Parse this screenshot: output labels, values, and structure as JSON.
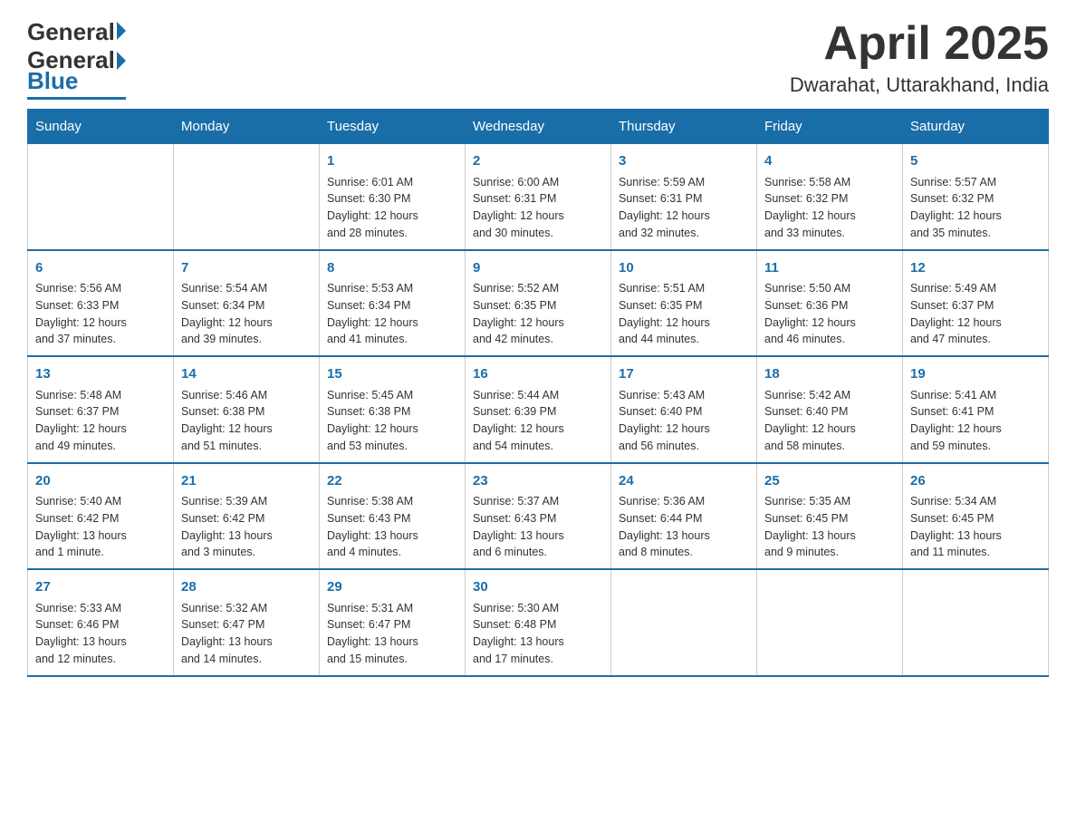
{
  "header": {
    "logo_general": "General",
    "logo_blue": "Blue",
    "month": "April 2025",
    "location": "Dwarahat, Uttarakhand, India"
  },
  "days_of_week": [
    "Sunday",
    "Monday",
    "Tuesday",
    "Wednesday",
    "Thursday",
    "Friday",
    "Saturday"
  ],
  "weeks": [
    [
      {
        "day": "",
        "info": ""
      },
      {
        "day": "",
        "info": ""
      },
      {
        "day": "1",
        "info": "Sunrise: 6:01 AM\nSunset: 6:30 PM\nDaylight: 12 hours\nand 28 minutes."
      },
      {
        "day": "2",
        "info": "Sunrise: 6:00 AM\nSunset: 6:31 PM\nDaylight: 12 hours\nand 30 minutes."
      },
      {
        "day": "3",
        "info": "Sunrise: 5:59 AM\nSunset: 6:31 PM\nDaylight: 12 hours\nand 32 minutes."
      },
      {
        "day": "4",
        "info": "Sunrise: 5:58 AM\nSunset: 6:32 PM\nDaylight: 12 hours\nand 33 minutes."
      },
      {
        "day": "5",
        "info": "Sunrise: 5:57 AM\nSunset: 6:32 PM\nDaylight: 12 hours\nand 35 minutes."
      }
    ],
    [
      {
        "day": "6",
        "info": "Sunrise: 5:56 AM\nSunset: 6:33 PM\nDaylight: 12 hours\nand 37 minutes."
      },
      {
        "day": "7",
        "info": "Sunrise: 5:54 AM\nSunset: 6:34 PM\nDaylight: 12 hours\nand 39 minutes."
      },
      {
        "day": "8",
        "info": "Sunrise: 5:53 AM\nSunset: 6:34 PM\nDaylight: 12 hours\nand 41 minutes."
      },
      {
        "day": "9",
        "info": "Sunrise: 5:52 AM\nSunset: 6:35 PM\nDaylight: 12 hours\nand 42 minutes."
      },
      {
        "day": "10",
        "info": "Sunrise: 5:51 AM\nSunset: 6:35 PM\nDaylight: 12 hours\nand 44 minutes."
      },
      {
        "day": "11",
        "info": "Sunrise: 5:50 AM\nSunset: 6:36 PM\nDaylight: 12 hours\nand 46 minutes."
      },
      {
        "day": "12",
        "info": "Sunrise: 5:49 AM\nSunset: 6:37 PM\nDaylight: 12 hours\nand 47 minutes."
      }
    ],
    [
      {
        "day": "13",
        "info": "Sunrise: 5:48 AM\nSunset: 6:37 PM\nDaylight: 12 hours\nand 49 minutes."
      },
      {
        "day": "14",
        "info": "Sunrise: 5:46 AM\nSunset: 6:38 PM\nDaylight: 12 hours\nand 51 minutes."
      },
      {
        "day": "15",
        "info": "Sunrise: 5:45 AM\nSunset: 6:38 PM\nDaylight: 12 hours\nand 53 minutes."
      },
      {
        "day": "16",
        "info": "Sunrise: 5:44 AM\nSunset: 6:39 PM\nDaylight: 12 hours\nand 54 minutes."
      },
      {
        "day": "17",
        "info": "Sunrise: 5:43 AM\nSunset: 6:40 PM\nDaylight: 12 hours\nand 56 minutes."
      },
      {
        "day": "18",
        "info": "Sunrise: 5:42 AM\nSunset: 6:40 PM\nDaylight: 12 hours\nand 58 minutes."
      },
      {
        "day": "19",
        "info": "Sunrise: 5:41 AM\nSunset: 6:41 PM\nDaylight: 12 hours\nand 59 minutes."
      }
    ],
    [
      {
        "day": "20",
        "info": "Sunrise: 5:40 AM\nSunset: 6:42 PM\nDaylight: 13 hours\nand 1 minute."
      },
      {
        "day": "21",
        "info": "Sunrise: 5:39 AM\nSunset: 6:42 PM\nDaylight: 13 hours\nand 3 minutes."
      },
      {
        "day": "22",
        "info": "Sunrise: 5:38 AM\nSunset: 6:43 PM\nDaylight: 13 hours\nand 4 minutes."
      },
      {
        "day": "23",
        "info": "Sunrise: 5:37 AM\nSunset: 6:43 PM\nDaylight: 13 hours\nand 6 minutes."
      },
      {
        "day": "24",
        "info": "Sunrise: 5:36 AM\nSunset: 6:44 PM\nDaylight: 13 hours\nand 8 minutes."
      },
      {
        "day": "25",
        "info": "Sunrise: 5:35 AM\nSunset: 6:45 PM\nDaylight: 13 hours\nand 9 minutes."
      },
      {
        "day": "26",
        "info": "Sunrise: 5:34 AM\nSunset: 6:45 PM\nDaylight: 13 hours\nand 11 minutes."
      }
    ],
    [
      {
        "day": "27",
        "info": "Sunrise: 5:33 AM\nSunset: 6:46 PM\nDaylight: 13 hours\nand 12 minutes."
      },
      {
        "day": "28",
        "info": "Sunrise: 5:32 AM\nSunset: 6:47 PM\nDaylight: 13 hours\nand 14 minutes."
      },
      {
        "day": "29",
        "info": "Sunrise: 5:31 AM\nSunset: 6:47 PM\nDaylight: 13 hours\nand 15 minutes."
      },
      {
        "day": "30",
        "info": "Sunrise: 5:30 AM\nSunset: 6:48 PM\nDaylight: 13 hours\nand 17 minutes."
      },
      {
        "day": "",
        "info": ""
      },
      {
        "day": "",
        "info": ""
      },
      {
        "day": "",
        "info": ""
      }
    ]
  ]
}
